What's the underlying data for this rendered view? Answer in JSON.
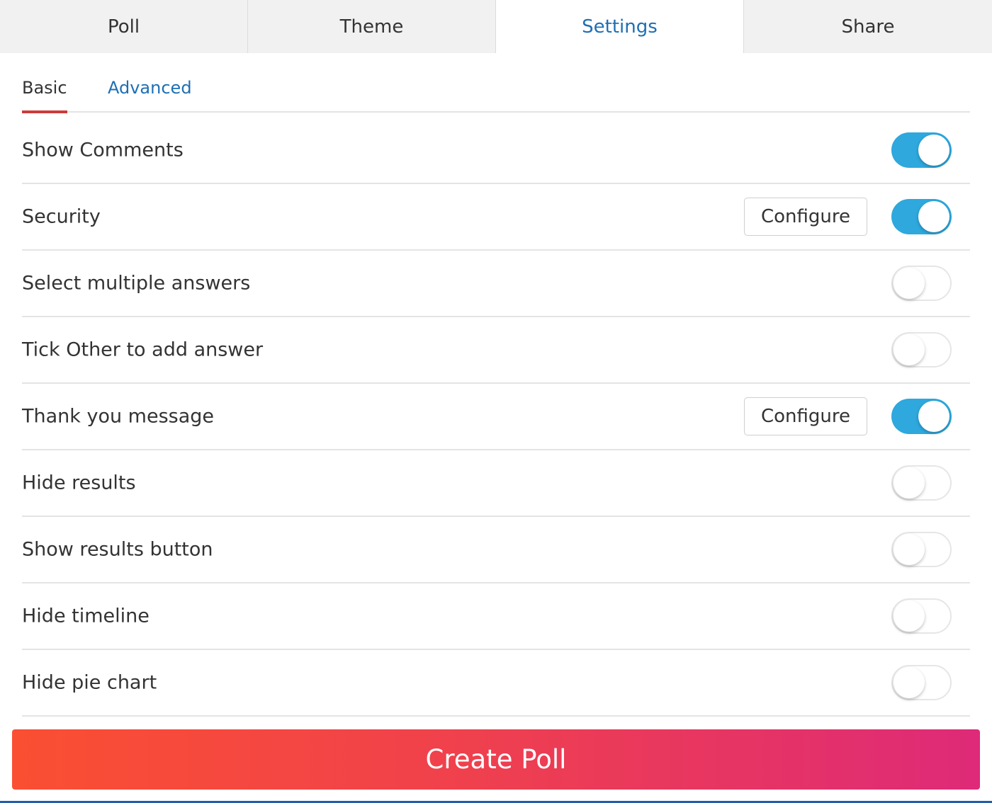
{
  "top_tabs": [
    {
      "label": "Poll",
      "active": false
    },
    {
      "label": "Theme",
      "active": false
    },
    {
      "label": "Settings",
      "active": true
    },
    {
      "label": "Share",
      "active": false
    }
  ],
  "sub_tabs": [
    {
      "label": "Basic",
      "active": true
    },
    {
      "label": "Advanced",
      "active": false
    }
  ],
  "settings": [
    {
      "label": "Show Comments",
      "enabled": true,
      "configure": null
    },
    {
      "label": "Security",
      "enabled": true,
      "configure": "Configure"
    },
    {
      "label": "Select multiple answers",
      "enabled": false,
      "configure": null
    },
    {
      "label": "Tick Other to add answer",
      "enabled": false,
      "configure": null
    },
    {
      "label": "Thank you message",
      "enabled": true,
      "configure": "Configure"
    },
    {
      "label": "Hide results",
      "enabled": false,
      "configure": null
    },
    {
      "label": "Show results button",
      "enabled": false,
      "configure": null
    },
    {
      "label": "Hide timeline",
      "enabled": false,
      "configure": null
    },
    {
      "label": "Hide pie chart",
      "enabled": false,
      "configure": null
    }
  ],
  "actions": {
    "create_label": "Create Poll"
  },
  "colors": {
    "accent": "#1e6fb3",
    "toggle_on": "#2ea8dd",
    "active_underline": "#cc3a3a",
    "create_gradient_start": "#fb4f32",
    "create_gradient_end": "#de2a78"
  }
}
